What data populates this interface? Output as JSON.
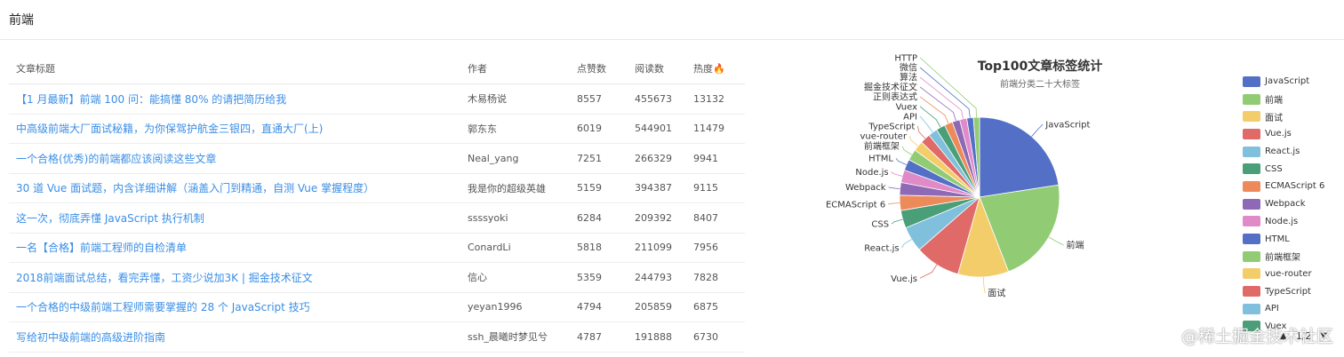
{
  "header": {
    "title": "前端"
  },
  "table": {
    "columns": [
      "文章标题",
      "作者",
      "点赞数",
      "阅读数",
      "热度🔥"
    ],
    "rows": [
      {
        "title": "【1 月最新】前端 100 问：能搞懂 80% 的请把简历给我",
        "author": "木易杨说",
        "likes": "8557",
        "views": "455673",
        "heat": "13132"
      },
      {
        "title": "中高级前端大厂面试秘籍，为你保驾护航金三银四，直通大厂(上)",
        "author": "郭东东",
        "likes": "6019",
        "views": "544901",
        "heat": "11479"
      },
      {
        "title": "一个合格(优秀)的前端都应该阅读这些文章",
        "author": "Neal_yang",
        "likes": "7251",
        "views": "266329",
        "heat": "9941"
      },
      {
        "title": "30 道 Vue 面试题，内含详细讲解（涵盖入门到精通，自测 Vue 掌握程度）",
        "author": "我是你的超级英雄",
        "likes": "5159",
        "views": "394387",
        "heat": "9115"
      },
      {
        "title": "这一次，彻底弄懂 JavaScript 执行机制",
        "author": "ssssyoki",
        "likes": "6284",
        "views": "209392",
        "heat": "8407"
      },
      {
        "title": "一名【合格】前端工程师的自检清单",
        "author": "ConardLi",
        "likes": "5818",
        "views": "211099",
        "heat": "7956"
      },
      {
        "title": "2018前端面试总结，看完弄懂，工资少说加3K | 掘金技术征文",
        "author": "信心",
        "likes": "5359",
        "views": "244793",
        "heat": "7828"
      },
      {
        "title": "一个合格的中级前端工程师需要掌握的 28 个 JavaScript 技巧",
        "author": "yeyan1996",
        "likes": "4794",
        "views": "205859",
        "heat": "6875"
      },
      {
        "title": "写给初中级前端的高级进阶指南",
        "author": "ssh_晨曦时梦见兮",
        "likes": "4787",
        "views": "191888",
        "heat": "6730"
      }
    ]
  },
  "chart_data": {
    "type": "pie",
    "title": "Top100文章标签统计",
    "subtitle": "前端分类二十大标签",
    "legend_position": "right",
    "slices": [
      {
        "label": "JavaScript",
        "value": 22,
        "color": "#5470c6"
      },
      {
        "label": "前端",
        "value": 21,
        "color": "#91cc75"
      },
      {
        "label": "面试",
        "value": 10,
        "color": "#f4cd6b"
      },
      {
        "label": "Vue.js",
        "value": 9,
        "color": "#e06a68"
      },
      {
        "label": "React.js",
        "value": 5,
        "color": "#80c0dc"
      },
      {
        "label": "CSS",
        "value": 3.5,
        "color": "#4a9e78"
      },
      {
        "label": "ECMAScript 6",
        "value": 3,
        "color": "#ec8a5a"
      },
      {
        "label": "Webpack",
        "value": 2.5,
        "color": "#8e69b5"
      },
      {
        "label": "Node.js",
        "value": 2.5,
        "color": "#e08ac8"
      },
      {
        "label": "HTML",
        "value": 2.2,
        "color": "#5470c6"
      },
      {
        "label": "前端框架",
        "value": 2.2,
        "color": "#91cc75"
      },
      {
        "label": "vue-router",
        "value": 2,
        "color": "#f4cd6b"
      },
      {
        "label": "TypeScript",
        "value": 2,
        "color": "#e06a68"
      },
      {
        "label": "API",
        "value": 1.8,
        "color": "#80c0dc"
      },
      {
        "label": "Vuex",
        "value": 1.8,
        "color": "#4a9e78"
      },
      {
        "label": "正则表达式",
        "value": 1.6,
        "color": "#ec8a5a"
      },
      {
        "label": "掘金技术征文",
        "value": 1.5,
        "color": "#8e69b5"
      },
      {
        "label": "算法",
        "value": 1.4,
        "color": "#e08ac8"
      },
      {
        "label": "微信",
        "value": 1.3,
        "color": "#5470c6"
      },
      {
        "label": "HTTP",
        "value": 1.2,
        "color": "#91cc75"
      }
    ],
    "legend_visible": [
      "JavaScript",
      "前端",
      "面试",
      "Vue.js",
      "React.js",
      "CSS",
      "ECMAScript 6",
      "Webpack",
      "Node.js",
      "HTML",
      "前端框架",
      "vue-router",
      "TypeScript",
      "API",
      "Vuex"
    ]
  },
  "pager": {
    "text": "1/2"
  },
  "watermark": {
    "text": "@稀土掘金技术社区"
  }
}
